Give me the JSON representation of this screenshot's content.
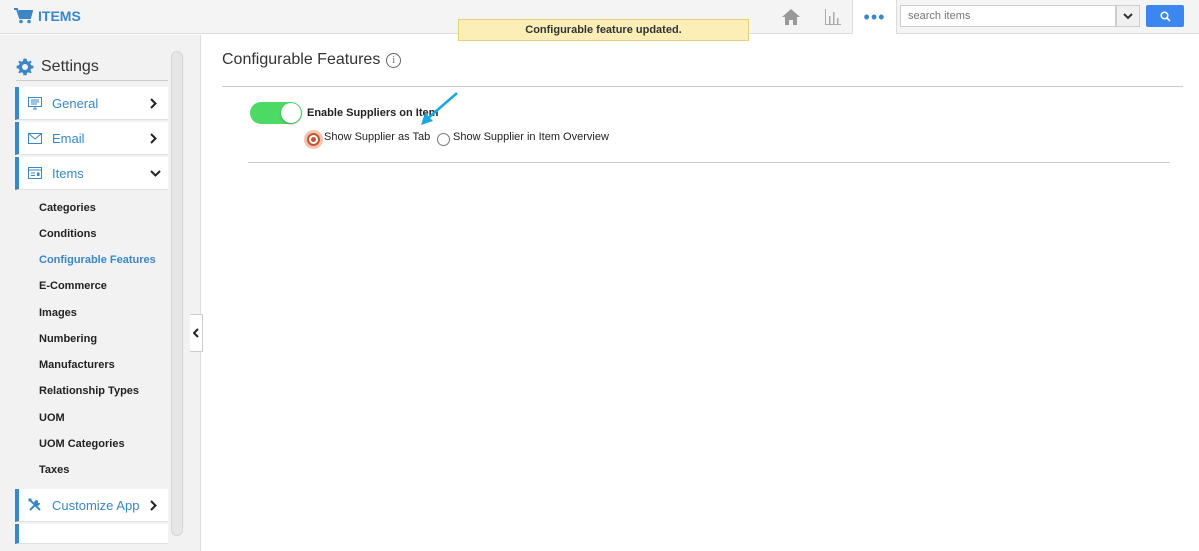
{
  "app": {
    "title": "ITEMS",
    "icon": "cart-icon"
  },
  "toast": {
    "message": "Configurable feature updated."
  },
  "top_nav": {
    "icons": [
      "home-icon",
      "bar-chart-icon",
      "more-icon"
    ],
    "more_label": "•••"
  },
  "search": {
    "placeholder": "search items",
    "value": ""
  },
  "sidebar": {
    "title": "Settings",
    "items": [
      {
        "label": "General",
        "icon": "monitor-icon",
        "expanded": false
      },
      {
        "label": "Email",
        "icon": "envelope-icon",
        "expanded": false
      },
      {
        "label": "Items",
        "icon": "items-icon",
        "expanded": true
      },
      {
        "label": "Customize App",
        "icon": "tools-icon",
        "expanded": false
      }
    ],
    "subitems": [
      {
        "label": "Categories"
      },
      {
        "label": "Conditions"
      },
      {
        "label": "Configurable Features",
        "active": true
      },
      {
        "label": "E-Commerce"
      },
      {
        "label": "Images"
      },
      {
        "label": "Numbering"
      },
      {
        "label": "Manufacturers"
      },
      {
        "label": "Relationship Types"
      },
      {
        "label": "UOM"
      },
      {
        "label": "UOM Categories"
      },
      {
        "label": "Taxes"
      }
    ]
  },
  "main": {
    "title": "Configurable Features",
    "info_glyph": "i",
    "toggle": {
      "label": "Enable Suppliers on Item",
      "on": true
    },
    "options": [
      {
        "label": "Show Supplier as Tab",
        "selected": true
      },
      {
        "label": "Show Supplier in Item Overview",
        "selected": false
      }
    ]
  },
  "colors": {
    "accent": "#3a87c8",
    "toggle_on": "#4cd964",
    "toast_bg": "#fbeeb7",
    "radio_selected": "#c4572b"
  }
}
